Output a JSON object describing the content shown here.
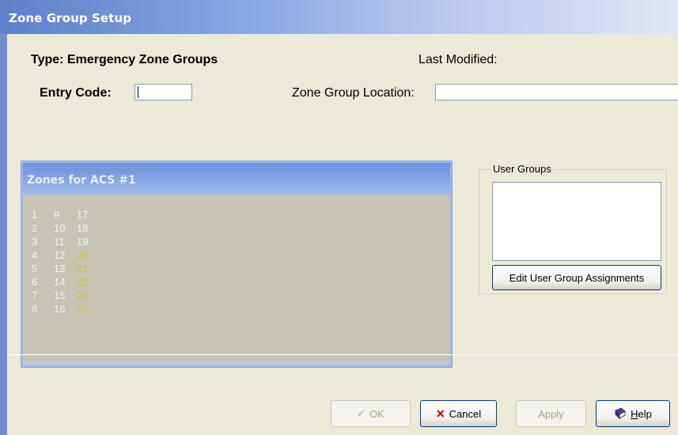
{
  "window": {
    "title": "Zone Group Setup"
  },
  "form": {
    "type_label": "Type: Emergency Zone Groups",
    "last_modified_label": "Last Modified:",
    "entry_code_label": "Entry Code:",
    "entry_code_value": "",
    "location_label": "Zone Group Location:",
    "location_value": ""
  },
  "zones_panel": {
    "title": "Zones for ACS #1",
    "columns": [
      [
        "1",
        "2",
        "3",
        "4",
        "5",
        "6",
        "7",
        "8"
      ],
      [
        "9",
        "10",
        "11",
        "12",
        "13",
        "14",
        "15",
        "16"
      ],
      [
        "17",
        "18",
        "19",
        "20",
        "21",
        "22",
        "23",
        "24"
      ]
    ],
    "highlight_color": "#c8c437",
    "normal_color": "#f2f2f2"
  },
  "user_groups": {
    "label": "User Groups",
    "edit_button": "Edit User Group Assignments"
  },
  "buttons": {
    "ok": "OK",
    "cancel": "Cancel",
    "apply": "Apply",
    "help_prefix": "H",
    "help_rest": "elp"
  }
}
